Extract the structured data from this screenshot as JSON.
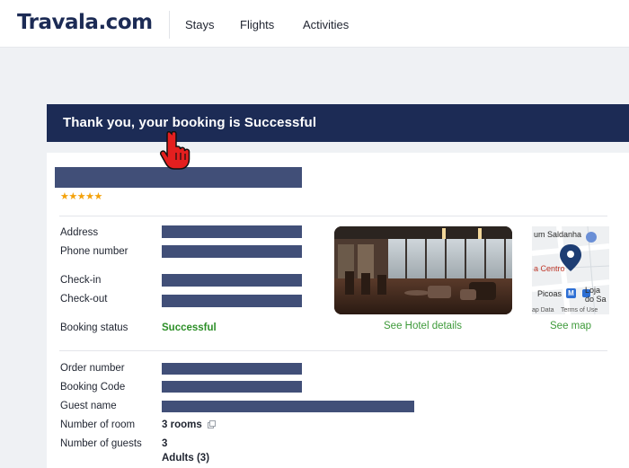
{
  "header": {
    "logo": "Travala.com",
    "nav": [
      "Stays",
      "Flights",
      "Activities"
    ]
  },
  "banner": {
    "message": "Thank you, your booking is Successful"
  },
  "hotel": {
    "stars": "★★★★★",
    "rating": 5,
    "labels": {
      "address": "Address",
      "phone": "Phone number",
      "checkin": "Check-in",
      "checkout": "Check-out",
      "status": "Booking status"
    },
    "status_value": "Successful",
    "see_hotel_details": "See Hotel details",
    "see_map": "See map",
    "map": {
      "place_top": "um Saldanha",
      "place_mid": "a Centro",
      "place_metro": "Picoas",
      "metro_badge": "M",
      "place_right_1": "Loja",
      "place_right_2": "do Sa",
      "footer_left": "ap Data",
      "footer_right": "Terms of Use"
    }
  },
  "order": {
    "labels": {
      "order_number": "Order number",
      "booking_code": "Booking Code",
      "guest_name": "Guest name",
      "rooms": "Number of room",
      "guests": "Number of guests"
    },
    "rooms_value": "3 rooms",
    "guests_value": "3",
    "adults_value": "Adults (3)"
  },
  "colors": {
    "navy": "#1c2b55",
    "redaction": "#414f78",
    "success_green": "#2d8f28",
    "link_green": "#3e9a3a",
    "star_gold": "#f4a20b"
  },
  "icons": [
    "pointer-hand-cursor-icon",
    "copy-icon",
    "map-pin-icon",
    "metro-icon",
    "shopping-bag-icon"
  ]
}
